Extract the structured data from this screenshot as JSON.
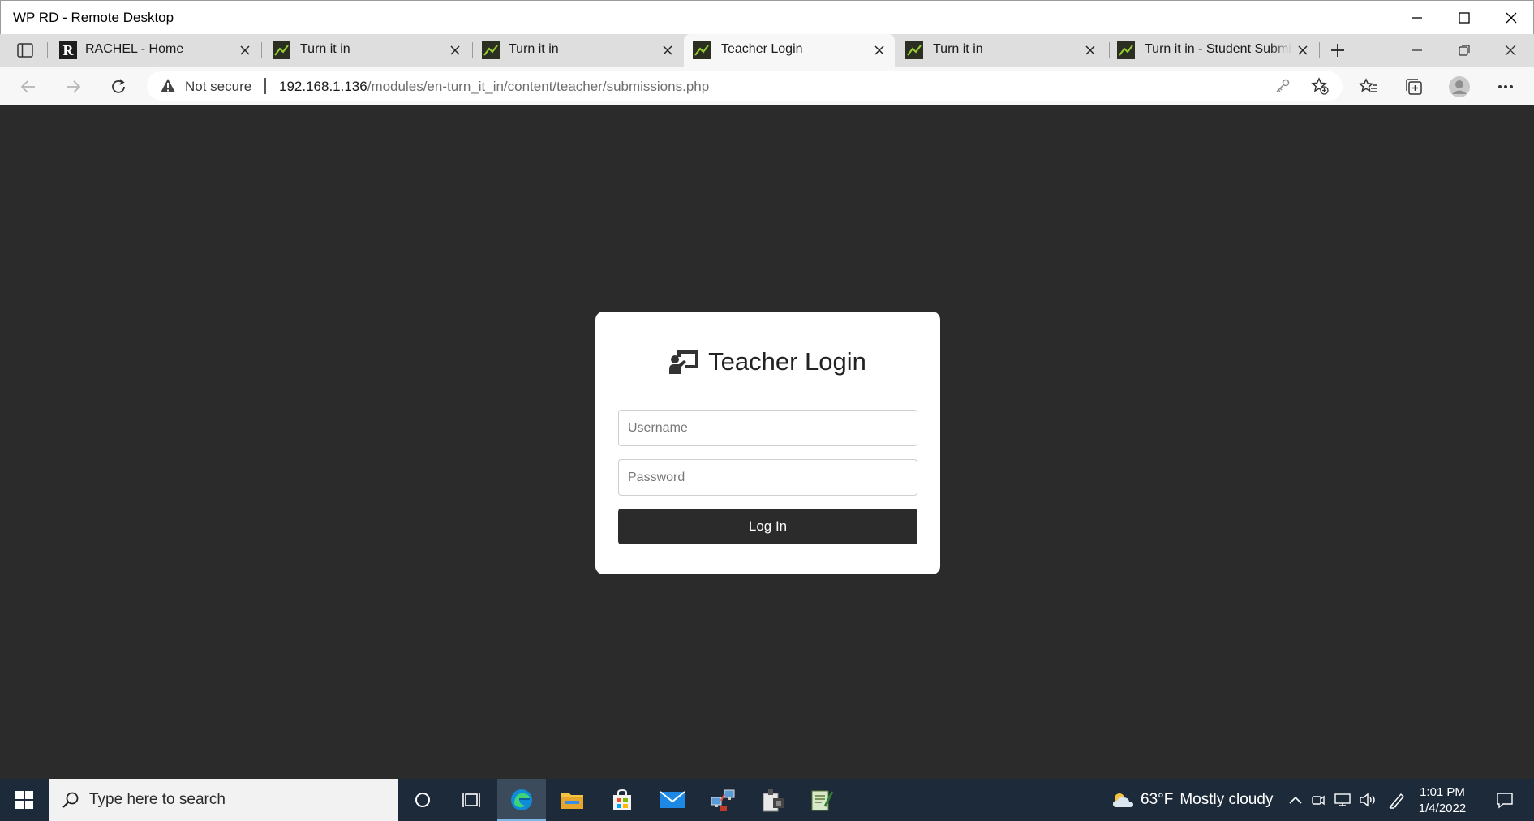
{
  "window": {
    "title": "WP RD - Remote Desktop"
  },
  "tabs": [
    {
      "label": "RACHEL - Home",
      "favicon": "rachel-r-icon",
      "active": false
    },
    {
      "label": "Turn it in",
      "favicon": "turnitin-icon",
      "active": false
    },
    {
      "label": "Turn it in",
      "favicon": "turnitin-icon",
      "active": false
    },
    {
      "label": "Teacher Login",
      "favicon": "turnitin-icon",
      "active": true
    },
    {
      "label": "Turn it in",
      "favicon": "turnitin-icon",
      "active": false
    },
    {
      "label": "Turn it in - Student Submis",
      "favicon": "turnitin-icon",
      "active": false
    }
  ],
  "address_bar": {
    "security_label": "Not secure",
    "url_host": "192.168.1.136",
    "url_path": "/modules/en-turn_it_in/content/teacher/submissions.php"
  },
  "login": {
    "title": "Teacher Login",
    "username_placeholder": "Username",
    "password_placeholder": "Password",
    "button_label": "Log In"
  },
  "taskbar": {
    "search_placeholder": "Type here to search",
    "weather_temp": "63°F",
    "weather_text": "Mostly cloudy",
    "time": "1:01 PM",
    "date": "1/4/2022"
  },
  "colors": {
    "page_background": "#2b2b2b",
    "card_background": "#ffffff",
    "button_background": "#2b2b2b",
    "taskbar_background": "#1c2a3a"
  }
}
